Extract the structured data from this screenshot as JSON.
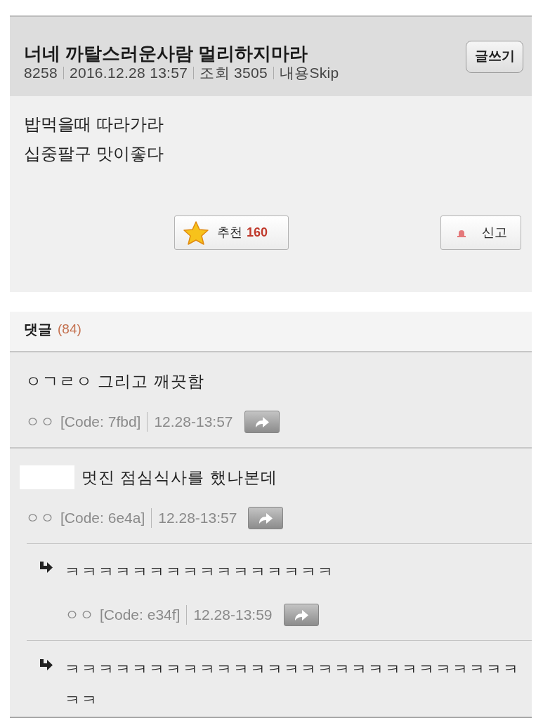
{
  "post": {
    "title": "너네 까탈스러운사람 멀리하지마라",
    "meta": {
      "number": "8258",
      "date": "2016.12.28 13:57",
      "views": "조회 3505",
      "skip": "내용Skip"
    },
    "write_button": "글쓰기",
    "body": [
      "밥먹을때 따라가라",
      "십중팔구 맛이좋다"
    ],
    "recommend_button": {
      "label": "추천",
      "count": "160"
    },
    "report_button": "신고"
  },
  "comments_header": {
    "label": "댓글",
    "count": "(84)"
  },
  "comments": [
    {
      "text": "ㅇㄱㄹㅇ 그리고 깨끗함",
      "name_hidden": false,
      "author": "ㅇㅇ",
      "code": "[Code: 7fbd]",
      "time": "12.28-13:57"
    },
    {
      "text": "멋진 점심식사를 했나본데",
      "name_hidden": true,
      "author": "ㅇㅇ",
      "code": "[Code: 6e4a]",
      "time": "12.28-13:57",
      "children": [
        {
          "text": "ㅋㅋㅋㅋㅋㅋㅋㅋㅋㅋㅋㅋㅋㅋㅋㅋ",
          "author": "ㅇㅇ",
          "code": "[Code: e34f]",
          "time": "12.28-13:59"
        },
        {
          "text": "ㅋㅋㅋㅋㅋㅋㅋㅋㅋㅋㅋㅋㅋㅋㅋㅋㅋㅋㅋㅋㅋㅋㅋㅋㅋㅋㅋㅋㅋ"
        }
      ]
    }
  ]
}
